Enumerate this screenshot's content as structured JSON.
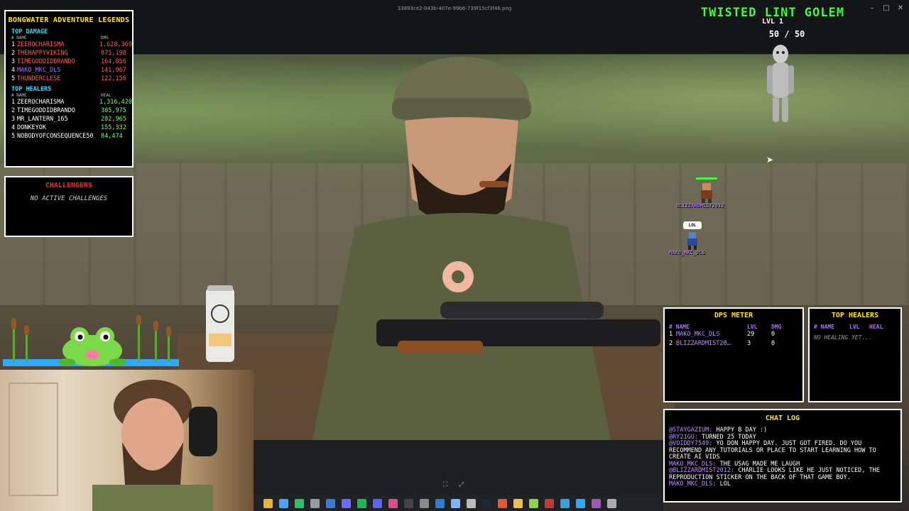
{
  "window": {
    "filename": "33893ce2-043b-407e-99b6-739f15cf3f46.png",
    "controls": [
      "–",
      "□",
      "✕"
    ]
  },
  "leaderboard": {
    "title": "BONGWATER ADVENTURE LEGENDS",
    "damage_title": "TOP DAMAGE",
    "damage_header": {
      "name": "# NAME",
      "value": "DMG"
    },
    "damage": [
      {
        "rank": "1",
        "name": "ZEEROCHARISMA",
        "value": "1,628,369",
        "color": "#ff5a5a"
      },
      {
        "rank": "2",
        "name": "THEHAPPYVIKING",
        "value": "871,190",
        "color": "#ff5a5a"
      },
      {
        "rank": "3",
        "name": "TIMEGODDIDBRANDO",
        "value": "164,856",
        "color": "#ff5a5a"
      },
      {
        "rank": "4",
        "name": "MAKO_MKC_DLS",
        "value": "141,967",
        "color": "#b06bff"
      },
      {
        "rank": "5",
        "name": "THUNDERCLESE",
        "value": "122,150",
        "color": "#ff5a5a"
      }
    ],
    "heal_title": "TOP HEALERS",
    "heal_header": {
      "name": "# NAME",
      "value": "HEAL"
    },
    "heals": [
      {
        "rank": "1",
        "name": "ZEEROCHARISMA",
        "value": "1,316,420"
      },
      {
        "rank": "2",
        "name": "TIMEGODDIDBRANDO",
        "value": "305,975"
      },
      {
        "rank": "3",
        "name": "MR_LANTERN_165",
        "value": "282,965"
      },
      {
        "rank": "4",
        "name": "DONKEYOK",
        "value": "155,332"
      },
      {
        "rank": "5",
        "name": "NOBODYOFCONSEQUENCE50",
        "value": "84,474"
      }
    ]
  },
  "challengers": {
    "title": "CHALLENGERS",
    "empty": "NO ACTIVE CHALLENGES"
  },
  "boss": {
    "name": "TWISTED LINT GOLEM",
    "level": "LVL 1",
    "hp": "50 / 50",
    "hp_fraction": 1.0
  },
  "players": [
    {
      "name": "BLIZZARDMIST2012"
    },
    {
      "name": "MAKO_MKC_DLS",
      "bubble": "LOL"
    }
  ],
  "dps_meter": {
    "title": "DPS METER",
    "header": {
      "name": "# NAME",
      "lvl": "LVL",
      "dmg": "DMG"
    },
    "rows": [
      {
        "rank": "1",
        "name": "MAKO_MKC_DLS",
        "lvl": "29",
        "dmg": "0"
      },
      {
        "rank": "2",
        "name": "BLIZZARDMIST20…",
        "lvl": "3",
        "dmg": "0"
      }
    ]
  },
  "top_healers": {
    "title": "TOP HEALERS",
    "header": {
      "name": "# NAME",
      "lvl": "LVL",
      "heal": "HEAL"
    },
    "empty": "NO HEALING YET..."
  },
  "chat_log": {
    "title": "CHAT LOG",
    "messages": [
      {
        "user": "@STAYGAZIUM:",
        "text": "HAPPY B DAY :)"
      },
      {
        "user": "@RY21GU:",
        "text": "TURNED 25 TODAY"
      },
      {
        "user": "@VOIDDY7549:",
        "text": "YO DON HAPPY DAY. JUST GOT FIRED. DO YOU RECOMMEND ANY TUTORIALS OR PLACE TO START LEARNING HOW TO CREATE AI VIDS"
      },
      {
        "user": "MAKO_MKC_DLS:",
        "text": "THE USAG MADE ME LAUGH"
      },
      {
        "user": "@BLIZZARDMIST2012:",
        "text": "CHARLIE LOOKS LIKE HE JUST NOTICED, THE REPRODUCTION STICKER ON THE BACK OF THAT GAME BOY."
      },
      {
        "user": "MAKO_MKC_DLS:",
        "text": "LOL"
      }
    ]
  },
  "taskbar_icons": [
    "file-explorer-icon",
    "chrome-icon",
    "edge-icon",
    "settings-icon",
    "mail-icon",
    "store-icon",
    "spotify-icon",
    "discord-icon",
    "photos-icon",
    "terminal-icon",
    "obs-icon",
    "vscode-icon",
    "notepad-icon",
    "calculator-icon",
    "steam-icon",
    "music-icon",
    "folder-icon",
    "camera-icon",
    "game-icon",
    "browser-icon",
    "photoshop-icon",
    "gallery-icon",
    "app-icon"
  ],
  "colors": {
    "panel_bg": "#000000",
    "panel_border": "#ffffff",
    "title_yellow": "#ffe600",
    "section_cyan": "#2fd9ff",
    "damage_red": "#ff5a5a",
    "heal_green": "#6dff6d",
    "username_purple": "#c08cff",
    "boss_green": "#3cff3c",
    "challengers_red": "#ff2424"
  }
}
